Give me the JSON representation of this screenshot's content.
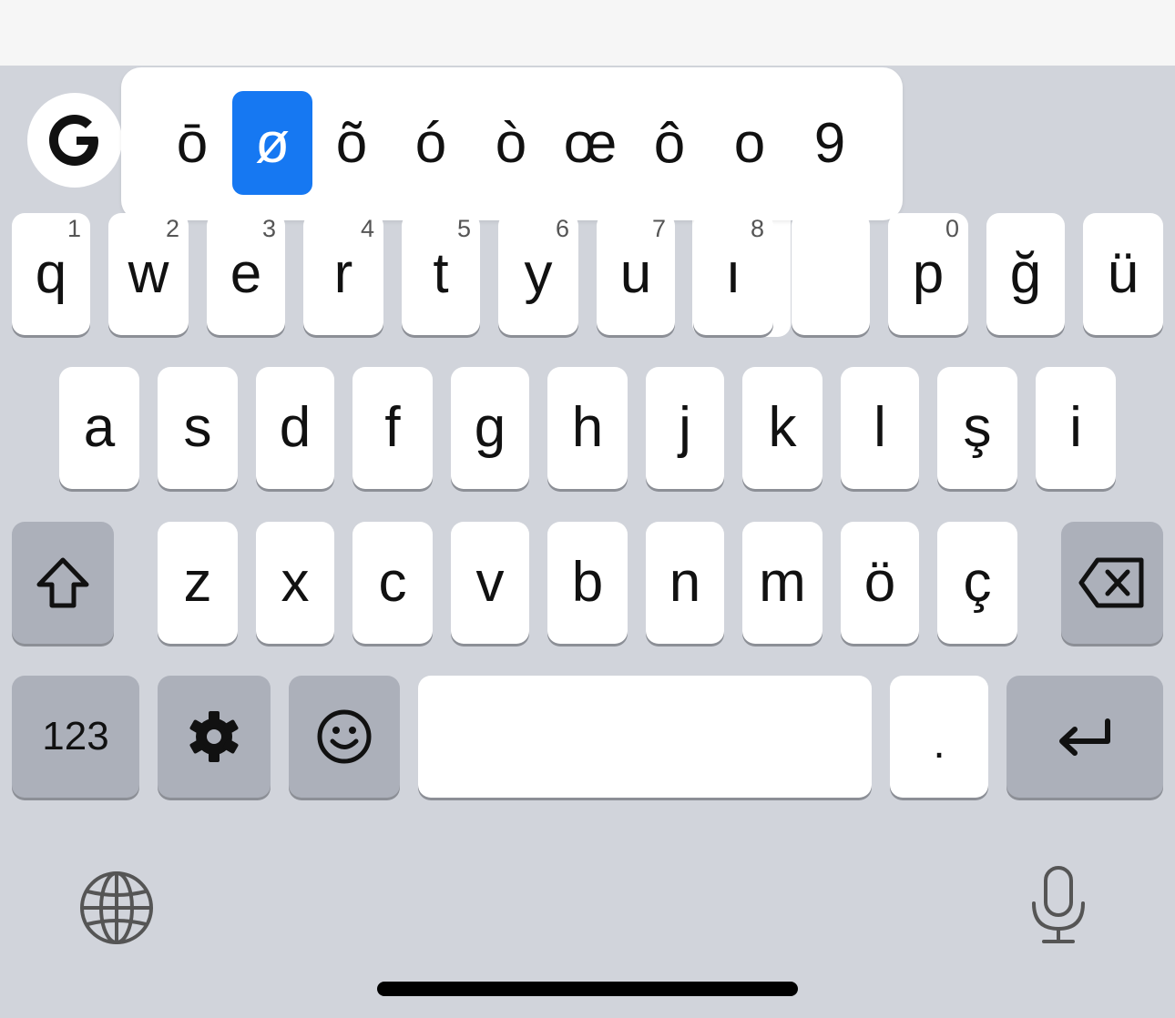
{
  "popup": {
    "alternates": [
      "ō",
      "ø",
      "õ",
      "ó",
      "ò",
      "œ",
      "ô",
      "o",
      "9"
    ],
    "selected": "ø"
  },
  "rows": {
    "row1": [
      {
        "letter": "q",
        "hint": "1"
      },
      {
        "letter": "w",
        "hint": "2"
      },
      {
        "letter": "e",
        "hint": "3"
      },
      {
        "letter": "r",
        "hint": "4"
      },
      {
        "letter": "t",
        "hint": "5"
      },
      {
        "letter": "y",
        "hint": "6"
      },
      {
        "letter": "u",
        "hint": "7"
      },
      {
        "letter": "ı",
        "hint": "8"
      },
      {
        "letter": "",
        "hint": ""
      },
      {
        "letter": "p",
        "hint": "0"
      },
      {
        "letter": "ğ",
        "hint": ""
      },
      {
        "letter": "ü",
        "hint": ""
      }
    ],
    "row2": [
      "a",
      "s",
      "d",
      "f",
      "g",
      "h",
      "j",
      "k",
      "l",
      "ş",
      "i"
    ],
    "row3": [
      "z",
      "x",
      "c",
      "v",
      "b",
      "n",
      "m",
      "ö",
      "ç"
    ]
  },
  "bottom": {
    "numbers_label": "123",
    "period_label": "."
  },
  "icons": {
    "logo": "google-g-icon",
    "shift": "shift-icon",
    "backspace": "backspace-icon",
    "settings": "gear-icon",
    "emoji": "emoji-icon",
    "return": "return-icon",
    "globe": "globe-icon",
    "mic": "microphone-icon"
  },
  "colors": {
    "selected_accent": "#1678f2",
    "keyboard_bg": "#d1d4db",
    "dark_key": "#acb0ba"
  }
}
